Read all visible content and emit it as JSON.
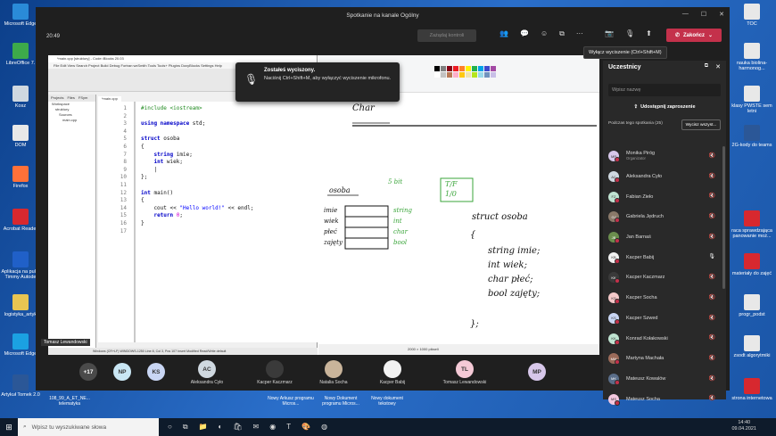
{
  "desktop_icons_left": [
    {
      "label": "Microsoft Edge",
      "color": "#2a8bd8"
    },
    {
      "label": "LibreOffice 7.",
      "color": "#3daa4a"
    },
    {
      "label": "Kosz",
      "color": "#cfd8e0"
    },
    {
      "label": "DOM",
      "color": "#e8e8e8"
    },
    {
      "label": "Firefox",
      "color": "#ff7139"
    },
    {
      "label": "Acrobat Reader",
      "color": "#d7282f"
    },
    {
      "label": "Aplikacja na pul... Timmy Autode",
      "color": "#2060c8"
    },
    {
      "label": "logistyka_artyk",
      "color": "#e8c552"
    },
    {
      "label": "Microsoft Edge",
      "color": "#1ba1e2"
    },
    {
      "label": "Artykuł Tomek 2.0",
      "color": "#2b5797"
    }
  ],
  "desktop_icons_right": [
    {
      "label": "TOC",
      "color": "#e8e8e8"
    },
    {
      "label": "nauka biolina-harmonog...",
      "color": "#e8e8e8"
    },
    {
      "label": "klasy PWSTE sem letni",
      "color": "#e8e8e8"
    },
    {
      "label": "2G-kody do teams",
      "color": "#2b5797"
    },
    {
      "label": "raca sprawdzająca panowanie moż...",
      "color": "#d7282f"
    },
    {
      "label": "materiały do zajęć",
      "color": "#d7282f"
    },
    {
      "label": "progr_podst",
      "color": "#e8e8e8"
    },
    {
      "label": "zsodt algorytmiki",
      "color": "#e8e8e8"
    },
    {
      "label": "strona internetowa",
      "color": "#d7282f"
    }
  ],
  "teams": {
    "window_title": "Spotkanie na kanale Ogólny",
    "timer": "20:49",
    "take_control": "Zażądaj kontroli",
    "hangup_label": "Zakończ",
    "tooltip": "Wyłącz wyciszenie (Ctrl+Shift+M)"
  },
  "notification": {
    "title": "Zostałeś wyciszony.",
    "body": "Naciśnij Ctrl+Shift+M, aby wyłączyć wyciszenie mikrofonu."
  },
  "codeblocks": {
    "title": "*main.cpp [struktury] - Code::Blocks 20.03",
    "menu": "File  Edit  View  Search  Project  Build  Debug  Fortran  wxSmith  Tools  Tools+  Plugins  DoxyBlocks  Settings  Help",
    "tab": "*main.cpp",
    "tree": [
      "Workspace",
      "struktury",
      "Sources",
      "main.cpp"
    ],
    "status": "Windows (CR+LF)    WINDOWS-1250    Line 8, Col 3, Pos 107    Insert    Modified    Read/Write    default",
    "code_lines": [
      {
        "n": "1",
        "html": "<span class='pp'>#include &lt;iostream&gt;</span>"
      },
      {
        "n": "2",
        "html": ""
      },
      {
        "n": "3",
        "html": "<span class='kw'>using namespace</span> std;"
      },
      {
        "n": "4",
        "html": ""
      },
      {
        "n": "5",
        "html": "<span class='kw'>struct</span> osoba"
      },
      {
        "n": "6",
        "html": "{"
      },
      {
        "n": "7",
        "html": "    <span class='kw'>string</span> imie;"
      },
      {
        "n": "8",
        "html": "    <span class='kw'>int</span> wiek;"
      },
      {
        "n": "9",
        "html": "    |"
      },
      {
        "n": "10",
        "html": "};"
      },
      {
        "n": "11",
        "html": ""
      },
      {
        "n": "12",
        "html": "<span class='kw'>int</span> main()"
      },
      {
        "n": "13",
        "html": "{"
      },
      {
        "n": "14",
        "html": "    cout &lt;&lt; <span class='str'>\"Hello world!\"</span> &lt;&lt; endl;"
      },
      {
        "n": "15",
        "html": "    <span class='kw'>return</span> <span class='num'>0</span>;"
      },
      {
        "n": "16",
        "html": "}"
      },
      {
        "n": "17",
        "html": ""
      }
    ]
  },
  "paint": {
    "status": "2000 × 1000 pikseli",
    "zoom": "100%",
    "palette": [
      "#000000",
      "#7f7f7f",
      "#880015",
      "#ed1c24",
      "#ff7f27",
      "#fff200",
      "#22b14c",
      "#00a2e8",
      "#3f48cc",
      "#a349a4",
      "#ffffff",
      "#c3c3c3",
      "#b97a57",
      "#ffaec9",
      "#ffc90e",
      "#efe4b0",
      "#b5e61d",
      "#99d9ea",
      "#7092be",
      "#c8bfe7"
    ],
    "handwriting": {
      "char": "Char",
      "osoba": "osoba",
      "fields": [
        "imie",
        "wiek",
        "płeć",
        "zajęty"
      ],
      "types": [
        "string",
        "int",
        "char",
        "bool"
      ],
      "size": "5 bit",
      "tf": "T/F",
      "tf2": "1/0",
      "code": [
        "struct  osoba",
        "{",
        "string imie;",
        "int wiek;",
        "char płeć;",
        "bool zajęty;",
        "};"
      ]
    }
  },
  "participants": {
    "title": "Uczestnicy",
    "search_placeholder": "Wpisz nazwę",
    "invite_label": "Udostępnij zaproszenie",
    "section_label": "Podczas tego spotkania (25)",
    "mute_all": "Wycisz wszyst...",
    "people": [
      {
        "name": "Monika Piróg",
        "sub": "Organizator",
        "initials": "MP",
        "color": "#d7c7ea",
        "mic_on": false
      },
      {
        "name": "Aleksandra Cyło",
        "sub": "",
        "initials": "AC",
        "color": "#cfd8e0",
        "mic_on": false
      },
      {
        "name": "Fabian Zieło",
        "sub": "",
        "initials": "FZ",
        "color": "#bfe3d1",
        "mic_on": false
      },
      {
        "name": "Gabriela Jędruch",
        "sub": "",
        "initials": "GJ",
        "color": "#8a7a6a",
        "mic_on": false
      },
      {
        "name": "Jan Barnaś",
        "sub": "",
        "initials": "JB",
        "color": "#6b8e4e",
        "mic_on": false
      },
      {
        "name": "Kacper Babij",
        "sub": "",
        "initials": "KB",
        "color": "#f2f2f2",
        "mic_on": true
      },
      {
        "name": "Kacper Kaczmarz",
        "sub": "",
        "initials": "KK",
        "color": "#3a3a3a",
        "mic_on": false
      },
      {
        "name": "Kacper Socha",
        "sub": "",
        "initials": "KS",
        "color": "#f4c9c9",
        "mic_on": false
      },
      {
        "name": "Kacper Szwed",
        "sub": "",
        "initials": "KS",
        "color": "#c9d6f4",
        "mic_on": false
      },
      {
        "name": "Konrad Kołakowski",
        "sub": "",
        "initials": "KK",
        "color": "#bfe3d1",
        "mic_on": false
      },
      {
        "name": "Martyna Machała",
        "sub": "",
        "initials": "MM",
        "color": "#9b6b5a",
        "mic_on": false
      },
      {
        "name": "Mateusz Kowalów",
        "sub": "",
        "initials": "MK",
        "color": "#5a6e8a",
        "mic_on": false
      },
      {
        "name": "Mateusz Socha",
        "sub": "",
        "initials": "MS",
        "color": "#f4c9e0",
        "mic_on": false
      }
    ]
  },
  "video_strip": {
    "presenter_label": "Tomasz Lewandowski",
    "more": "+17",
    "tiles": [
      {
        "initials": "NP",
        "name": "",
        "color": "#c9e6f4"
      },
      {
        "initials": "KS",
        "name": "",
        "color": "#c9d6f4"
      },
      {
        "initials": "AC",
        "name": "Aleksandra Cyło",
        "color": "#cfd8e0"
      },
      {
        "initials": "",
        "name": "Kacper Kaczmarz",
        "color": "#3a3a3a"
      },
      {
        "initials": "",
        "name": "Natalia Socha",
        "color": "#c9b49a"
      },
      {
        "initials": "",
        "name": "Kacper Babij",
        "color": "#f2f2f2"
      },
      {
        "initials": "TL",
        "name": "Tomasz Lewandowski",
        "color": "#f4c9d6"
      },
      {
        "initials": "MP",
        "name": "",
        "color": "#d7c7ea"
      }
    ]
  },
  "bottom_files": [
    {
      "label": "108_99_A_ET_NE... telematyka"
    },
    {
      "label": "Nowy Arkusz programu Micros..."
    },
    {
      "label": "Nowy Dokument programu Micros..."
    },
    {
      "label": "Nowy dokument tekstowy"
    }
  ],
  "os_taskbar": {
    "search_placeholder": "Wpisz tu wyszukiwane słowa",
    "time": "14:40",
    "date": "09.04.2021"
  }
}
